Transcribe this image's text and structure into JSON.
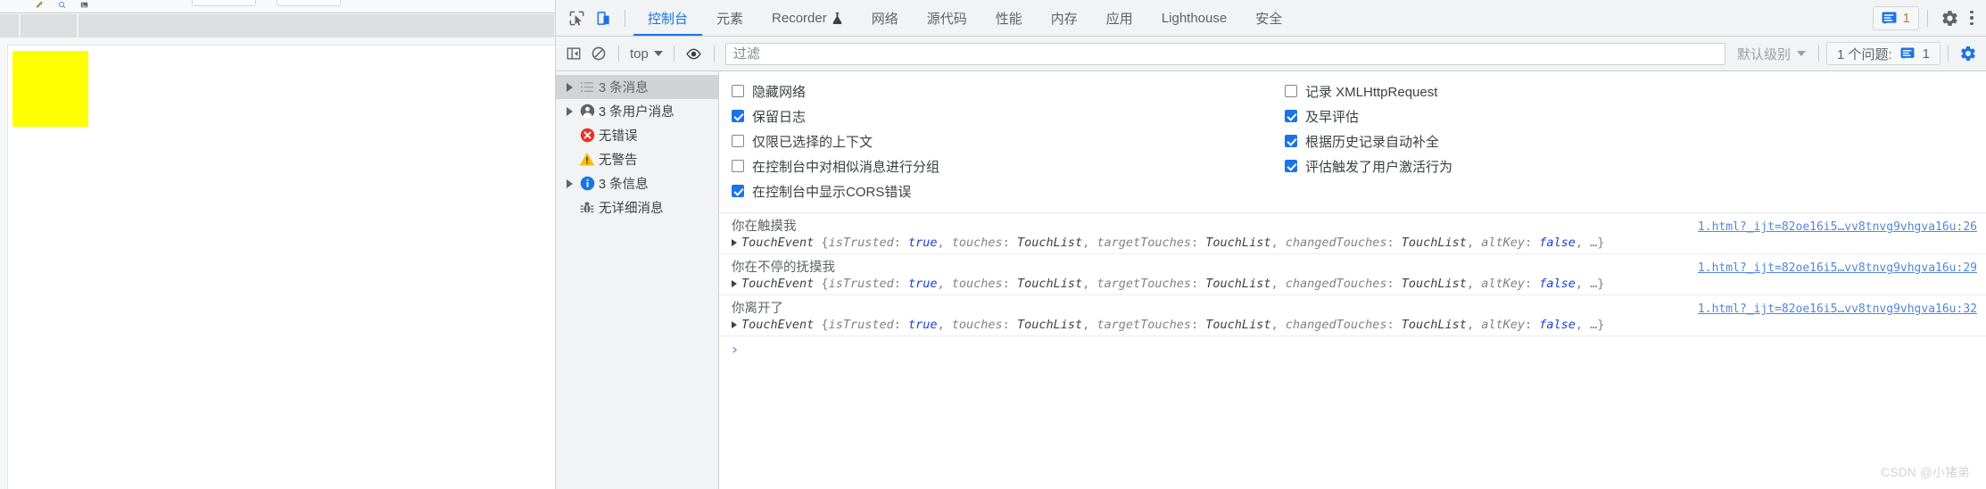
{
  "page_viewport": {
    "box_color": "#ffff00",
    "device_toolbar_color": "#dcdee1"
  },
  "devtools": {
    "toolbar": {
      "inspect_icon": "inspect-cursor-icon",
      "device_toggle_icon": "device-toolbar-icon",
      "tabs": [
        {
          "label": "控制台",
          "active": true,
          "badge": ""
        },
        {
          "label": "元素",
          "active": false,
          "badge": ""
        },
        {
          "label": "Recorder",
          "active": false,
          "badge": "flask-icon"
        },
        {
          "label": "网络",
          "active": false,
          "badge": ""
        },
        {
          "label": "源代码",
          "active": false,
          "badge": ""
        },
        {
          "label": "性能",
          "active": false,
          "badge": ""
        },
        {
          "label": "内存",
          "active": false,
          "badge": ""
        },
        {
          "label": "应用",
          "active": false,
          "badge": ""
        },
        {
          "label": "Lighthouse",
          "active": false,
          "badge": ""
        },
        {
          "label": "安全",
          "active": false,
          "badge": ""
        }
      ],
      "issues_count": "1",
      "settings_icon": "gear-icon",
      "more_icon": "kebab-menu-icon",
      "accent_color": "#1a73e8"
    },
    "filterbar": {
      "sidebar_toggle_icon": "show-console-sidebar-icon",
      "clear_icon": "clear-console-icon",
      "context": "top",
      "eye_icon": "live-expression-icon",
      "filter_placeholder": "过滤",
      "filter_value": "",
      "level": "默认级别",
      "issues_label": "1 个问题:",
      "issues_count": "1",
      "settings_icon": "console-settings-gear-icon"
    },
    "sidebar": [
      {
        "label": "3 条消息",
        "icon": "list-icon",
        "expandable": true,
        "selected": true
      },
      {
        "label": "3 条用户消息",
        "icon": "user-icon",
        "expandable": true,
        "selected": false
      },
      {
        "label": "无错误",
        "icon": "error-icon",
        "expandable": false,
        "selected": false
      },
      {
        "label": "无警告",
        "icon": "warning-icon",
        "expandable": false,
        "selected": false
      },
      {
        "label": "3 条信息",
        "icon": "info-icon",
        "expandable": true,
        "selected": false
      },
      {
        "label": "无详细消息",
        "icon": "verbose-bug-icon",
        "expandable": false,
        "selected": false
      }
    ],
    "settings": {
      "left_column": [
        {
          "label": "隐藏网络",
          "checked": false
        },
        {
          "label": "保留日志",
          "checked": true
        },
        {
          "label": "仅限已选择的上下文",
          "checked": false
        },
        {
          "label": "在控制台中对相似消息进行分组",
          "checked": false
        },
        {
          "label": "在控制台中显示CORS错误",
          "checked": true
        }
      ],
      "right_column": [
        {
          "label": "记录 XMLHttpRequest",
          "checked": false
        },
        {
          "label": "及早评估",
          "checked": true
        },
        {
          "label": "根据历史记录自动补全",
          "checked": true
        },
        {
          "label": "评估触发了用户激活行为",
          "checked": true
        }
      ]
    },
    "console_entries": [
      {
        "message": "你在触摸我",
        "source": "1.html?_ijt=82oe16i5…vv8tnvg9vhgva16u:26",
        "object": {
          "name": "TouchEvent",
          "open_brace": "{",
          "props": [
            {
              "key": "isTrusted",
              "val": "true",
              "kind": "bool"
            },
            {
              "key": "touches",
              "val": "TouchList",
              "kind": "type"
            },
            {
              "key": "targetTouches",
              "val": "TouchList",
              "kind": "type"
            },
            {
              "key": "changedTouches",
              "val": "TouchList",
              "kind": "type"
            },
            {
              "key": "altKey",
              "val": "false",
              "kind": "bool"
            }
          ],
          "ellipsis": "…}"
        }
      },
      {
        "message": "你在不停的抚摸我",
        "source": "1.html?_ijt=82oe16i5…vv8tnvg9vhgva16u:29",
        "object": {
          "name": "TouchEvent",
          "open_brace": "{",
          "props": [
            {
              "key": "isTrusted",
              "val": "true",
              "kind": "bool"
            },
            {
              "key": "touches",
              "val": "TouchList",
              "kind": "type"
            },
            {
              "key": "targetTouches",
              "val": "TouchList",
              "kind": "type"
            },
            {
              "key": "changedTouches",
              "val": "TouchList",
              "kind": "type"
            },
            {
              "key": "altKey",
              "val": "false",
              "kind": "bool"
            }
          ],
          "ellipsis": "…}"
        }
      },
      {
        "message": "你离开了",
        "source": "1.html?_ijt=82oe16i5…vv8tnvg9vhgva16u:32",
        "object": {
          "name": "TouchEvent",
          "open_brace": "{",
          "props": [
            {
              "key": "isTrusted",
              "val": "true",
              "kind": "bool"
            },
            {
              "key": "touches",
              "val": "TouchList",
              "kind": "type"
            },
            {
              "key": "targetTouches",
              "val": "TouchList",
              "kind": "type"
            },
            {
              "key": "changedTouches",
              "val": "TouchList",
              "kind": "type"
            },
            {
              "key": "altKey",
              "val": "false",
              "kind": "bool"
            }
          ],
          "ellipsis": "…}"
        }
      }
    ],
    "prompt_symbol": "›"
  },
  "watermark": "CSDN @小猪弟"
}
